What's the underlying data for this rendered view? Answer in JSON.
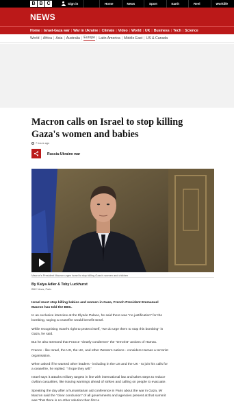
{
  "topbar": {
    "logo_letters": [
      "B",
      "B",
      "C"
    ],
    "signin_label": "Sign in",
    "nav": [
      "Home",
      "News",
      "Sport",
      "Earth",
      "Reel",
      "Worklife"
    ]
  },
  "banner": {
    "title": "NEWS"
  },
  "red_nav": [
    "Home",
    "Israel-Gaza war",
    "War in Ukraine",
    "Climate",
    "Video",
    "World",
    "UK",
    "Business",
    "Tech",
    "Science"
  ],
  "sub_nav": {
    "items": [
      "World",
      "Africa",
      "Asia",
      "Australia",
      "Europe",
      "Latin America",
      "Middle East",
      "US & Canada"
    ],
    "active": "Europe"
  },
  "article": {
    "headline": "Macron calls on Israel to stop killing Gaza's women and babies",
    "timestamp": "7 hours ago",
    "tag": "Russia-Ukraine war",
    "caption": "Macron's President Macron urges Israel to stop killing Gaza's women and children",
    "byline": "By Katya Adler & Toby Luckhurst",
    "byline_org": "BBC News, Paris",
    "paragraphs": [
      "Israel must stop killing babies and women in Gaza, French President Emmanuel Macron has told the BBC.",
      "In an exclusive interview at the Élysée Palace, he said there was \"no justification\" for the bombing, saying a ceasefire would benefit Israel.",
      "While recognising Israel's right to protect itself, \"we do urge them to stop this bombing\" in Gaza, he said.",
      "But he also stressed that France \"clearly condemns\" the \"terrorist\" actions of Hamas.",
      "France - like Israel, the US, the UK, and other Western nations - considers Hamas a terrorist organisation.",
      "When asked if he wanted other leaders - including in the US and the UK - to join his calls for a ceasefire, he replied: \"I hope they will.\"",
      "Israel says it attacks military targets in line with international law and takes steps to reduce civilian casualties, like issuing warnings ahead of strikes and calling on people to evacuate.",
      "Speaking the day after a humanitarian aid conference in Paris about the war in Gaza, Mr Macron said the \"clear conclusion\" of all governments and agencies present at that summit was \"that there is no other solution than first a"
    ]
  },
  "colors": {
    "brand_red": "#bb1919",
    "topbar": "#000000",
    "ad_bg": "#f2f2f2"
  },
  "icons": [
    "user-icon",
    "clock-icon",
    "share-icon",
    "play-icon"
  ]
}
